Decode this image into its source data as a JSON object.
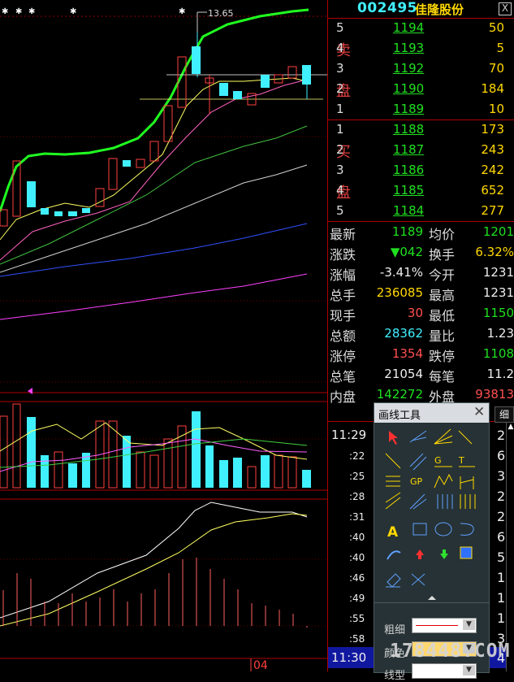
{
  "stock": {
    "code": "002495",
    "name": "佳隆股份",
    "close_label": "X"
  },
  "sell_label": [
    "卖",
    "盘"
  ],
  "buy_label": [
    "买",
    "盘"
  ],
  "sell": [
    {
      "level": "5",
      "price": "1194",
      "vol": "50"
    },
    {
      "level": "4",
      "price": "1193",
      "vol": "5"
    },
    {
      "level": "3",
      "price": "1192",
      "vol": "70"
    },
    {
      "level": "2",
      "price": "1190",
      "vol": "184"
    },
    {
      "level": "1",
      "price": "1189",
      "vol": "10"
    }
  ],
  "buy": [
    {
      "level": "1",
      "price": "1188",
      "vol": "173"
    },
    {
      "level": "2",
      "price": "1187",
      "vol": "243"
    },
    {
      "level": "3",
      "price": "1186",
      "vol": "242"
    },
    {
      "level": "4",
      "price": "1185",
      "vol": "652"
    },
    {
      "level": "5",
      "price": "1184",
      "vol": "277"
    }
  ],
  "stats": [
    {
      "k1": "最新",
      "v1": "1189",
      "c1": "green",
      "k2": "均价",
      "v2": "1201",
      "c2": "green"
    },
    {
      "k1": "涨跌",
      "v1": "▼042",
      "c1": "green",
      "k2": "换手",
      "v2": "6.32%",
      "c2": "yellow"
    },
    {
      "k1": "涨幅",
      "v1": "-3.41%",
      "c1": "white",
      "k2": "今开",
      "v2": "1231",
      "c2": "white"
    },
    {
      "k1": "总手",
      "v1": "236085",
      "c1": "yellow",
      "k2": "最高",
      "v2": "1231",
      "c2": "white"
    },
    {
      "k1": "现手",
      "v1": "30",
      "c1": "red",
      "k2": "最低",
      "v2": "1150",
      "c2": "green"
    },
    {
      "k1": "总额",
      "v1": "28362",
      "c1": "cyan",
      "k2": "量比",
      "v2": "1.23",
      "c2": "white"
    },
    {
      "k1": "涨停",
      "v1": "1354",
      "c1": "red",
      "k2": "跌停",
      "v2": "1108",
      "c2": "green"
    },
    {
      "k1": "总笔",
      "v1": "21054",
      "c1": "white",
      "k2": "每笔",
      "v2": "11.2",
      "c2": "white"
    },
    {
      "k1": "内盘",
      "v1": "142272",
      "c1": "green",
      "k2": "外盘",
      "v2": "93813",
      "c2": "red"
    }
  ],
  "trades": {
    "tab_label": "细",
    "times": [
      "11:29",
      ":22",
      ":25",
      ":28",
      ":31",
      ":40",
      ":40",
      ":46",
      ":49",
      ":55",
      ":58",
      "11:30"
    ],
    "right_nums": [
      "2",
      "6",
      "3",
      "2",
      "2",
      "6",
      "5",
      "1",
      "1",
      "1",
      "3",
      "4"
    ]
  },
  "chart": {
    "high_label": "13.65",
    "date_label": "04"
  },
  "panel": {
    "title": "画线工具",
    "close": "✕",
    "label_thickness": "粗细",
    "label_color": "颜色",
    "label_linetype": "线型"
  },
  "watermark": "178448.COM"
}
